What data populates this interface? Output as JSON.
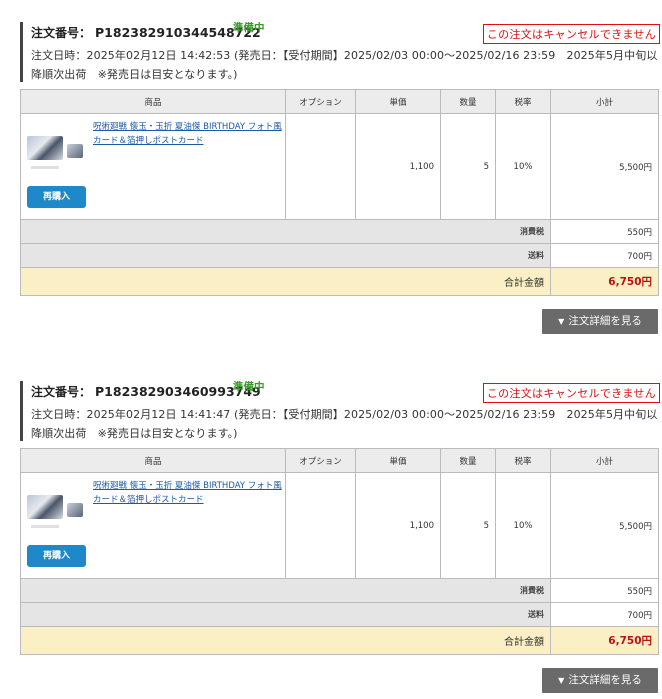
{
  "labels": {
    "order_number": "注文番号：",
    "order_datetime": "注文日時：",
    "cancel_note": "この注文はキャンセルできません",
    "rebuy": "再購入",
    "tax": "消費税",
    "shipping": "送料",
    "total": "合計金額",
    "detail_button": "注文詳細を見る"
  },
  "columns": [
    "商品",
    "オプション",
    "単価",
    "数量",
    "税率",
    "小計"
  ],
  "orders": [
    {
      "number": "P182382910344548722",
      "status": "準備中",
      "datetime_line": "2025年02月12日 14:42:53 (発売日：【受付期間】2025/02/03 00:00～2025/02/16 23:59　2025年5月中旬以降順次出荷　※発売日は目安となります。)",
      "item": {
        "title": "呪術廻戦 懐玉・玉折 夏油傑 BIRTHDAY フォト風カード＆箔押しポストカード",
        "option": "",
        "unit_price": "1,100",
        "quantity": "5",
        "tax_rate": "10%",
        "subtotal": "5,500円"
      },
      "tax": "550円",
      "shipping": "700円",
      "total": "6,750円"
    },
    {
      "number": "P182382903460993749",
      "status": "準備中",
      "datetime_line": "2025年02月12日 14:41:47 (発売日：【受付期間】2025/02/03 00:00～2025/02/16 23:59　2025年5月中旬以降順次出荷　※発売日は目安となります。)",
      "item": {
        "title": "呪術廻戦 懐玉・玉折 夏油傑 BIRTHDAY フォト風カード＆箔押しポストカード",
        "option": "",
        "unit_price": "1,100",
        "quantity": "5",
        "tax_rate": "10%",
        "subtotal": "5,500円"
      },
      "tax": "550円",
      "shipping": "700円",
      "total": "6,750円"
    }
  ]
}
